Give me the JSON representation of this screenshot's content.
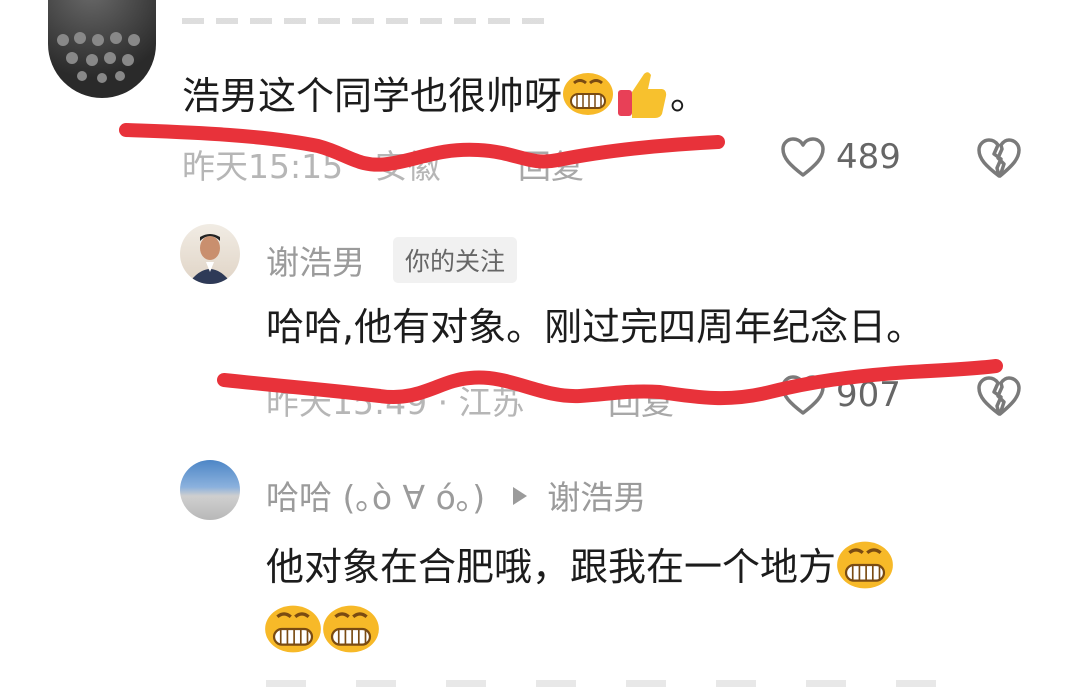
{
  "comments": [
    {
      "text": "浩男这个同学也很帅呀",
      "suffix": "。",
      "meta_time": "昨天15:15",
      "meta_location": "安徽",
      "reply_label": "回复",
      "like_count": "489"
    },
    {
      "username": "谢浩男",
      "badge": "你的关注",
      "text": "哈哈,他有对象。刚过完四周年纪念日。",
      "meta_time": "昨天15:49",
      "meta_location": "江苏",
      "reply_label": "回复",
      "like_count": "907"
    },
    {
      "username": "哈哈 (｡ò ∀ ó｡)",
      "reply_to": "谢浩男",
      "text": "他对象在合肥哦，跟我在一个地方"
    }
  ],
  "colors": {
    "scribble": "#e8323a",
    "text": "#1c1c1c",
    "meta": "#b6b6b6",
    "icon": "#8a8a8a"
  },
  "icons": {
    "like": "heart-outline-icon",
    "dislike": "broken-heart-icon",
    "arrow": "triangle-right-icon",
    "emoji_grin": "grinning-face-emoji",
    "emoji_thumb": "thumbs-up-emoji"
  }
}
